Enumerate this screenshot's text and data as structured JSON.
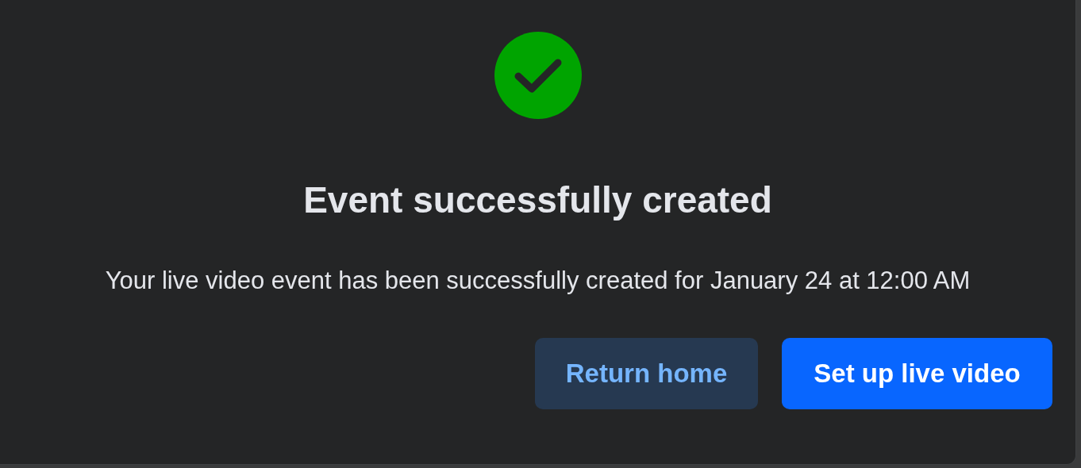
{
  "dialog": {
    "title": "Event successfully created",
    "message": "Your live video event has been successfully created for January 24 at 12:00 AM",
    "buttons": [
      {
        "label": "Return home",
        "kind": "secondary"
      },
      {
        "label": "Set up live video",
        "kind": "primary"
      }
    ]
  }
}
